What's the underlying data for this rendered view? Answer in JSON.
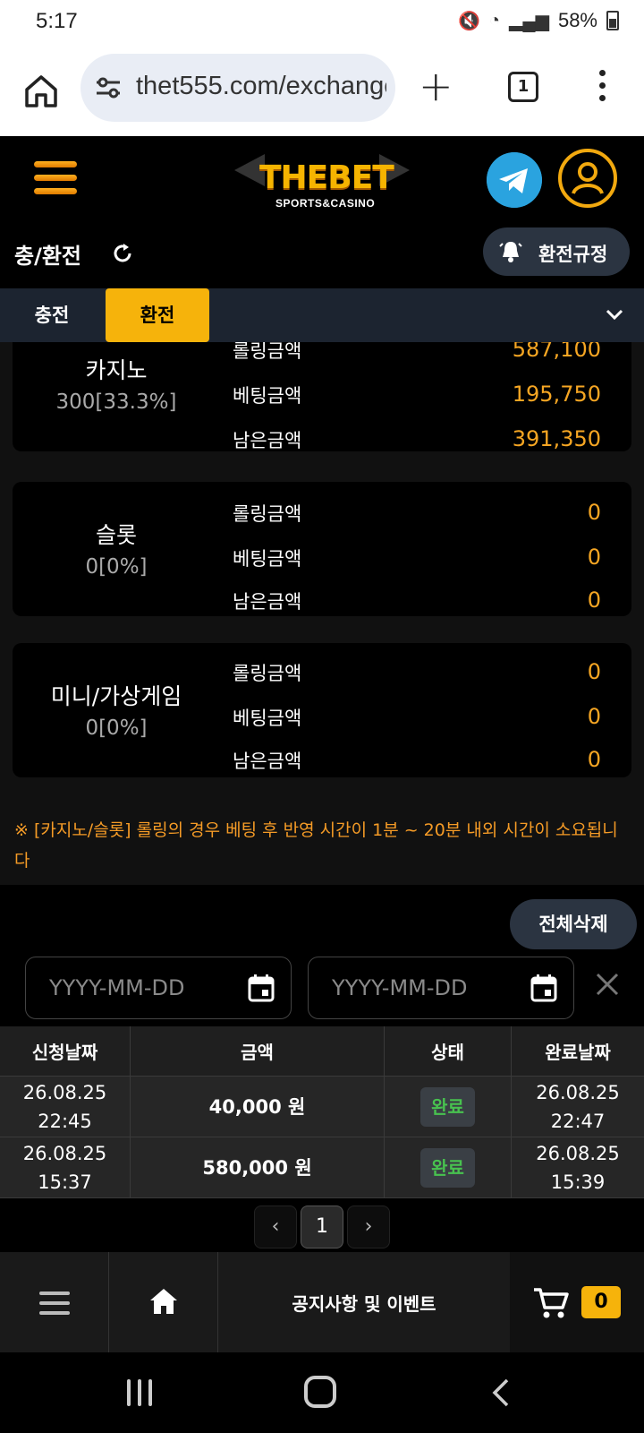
{
  "status_bar": {
    "time": "5:17",
    "battery": "58%"
  },
  "browser": {
    "url": "thet555.com/exchange",
    "tab_count": "1"
  },
  "header": {
    "logo_main": "THEBET",
    "logo_sub": "SPORTS&CASINO"
  },
  "page": {
    "title": "충/환전",
    "rules_button": "환전규정"
  },
  "tabs": [
    {
      "label": "충전",
      "active": false
    },
    {
      "label": "환전",
      "active": true
    }
  ],
  "rolling_cards": [
    {
      "name": "카지노",
      "rate": "300[33.3%]",
      "rows": [
        {
          "label": "롤링금액",
          "value": "587,100"
        },
        {
          "label": "베팅금액",
          "value": "195,750"
        },
        {
          "label": "남은금액",
          "value": "391,350"
        }
      ]
    },
    {
      "name": "슬롯",
      "rate": "0[0%]",
      "rows": [
        {
          "label": "롤링금액",
          "value": "0"
        },
        {
          "label": "베팅금액",
          "value": "0"
        },
        {
          "label": "남은금액",
          "value": "0"
        }
      ]
    },
    {
      "name": "미니/가상게임",
      "rate": "0[0%]",
      "rows": [
        {
          "label": "롤링금액",
          "value": "0"
        },
        {
          "label": "베팅금액",
          "value": "0"
        },
        {
          "label": "남은금액",
          "value": "0"
        }
      ]
    }
  ],
  "notice_text": "※ [카지노/슬롯] 롤링의 경우 베팅 후 반영 시간이 1분 ~ 20분 내외 시간이 소요됩니다",
  "history": {
    "delete_all": "전체삭제",
    "date_placeholder": "YYYY-MM-DD",
    "columns": [
      "신청날짜",
      "금액",
      "상태",
      "완료날짜"
    ],
    "rows": [
      {
        "req_date": "26.08.25",
        "req_time": "22:45",
        "amount": "40,000 원",
        "status": "완료",
        "done_date": "26.08.25",
        "done_time": "22:47"
      },
      {
        "req_date": "26.08.25",
        "req_time": "15:37",
        "amount": "580,000 원",
        "status": "완료",
        "done_date": "26.08.25",
        "done_time": "15:39"
      }
    ],
    "page": "1"
  },
  "bottom_nav": {
    "notice_label": "공지사항 및 이벤트",
    "cart_count": "0"
  },
  "colors": {
    "accent": "#f6b30b",
    "value": "#f6a623",
    "status_done": "#48c24f",
    "telegram": "#2aa3df"
  }
}
